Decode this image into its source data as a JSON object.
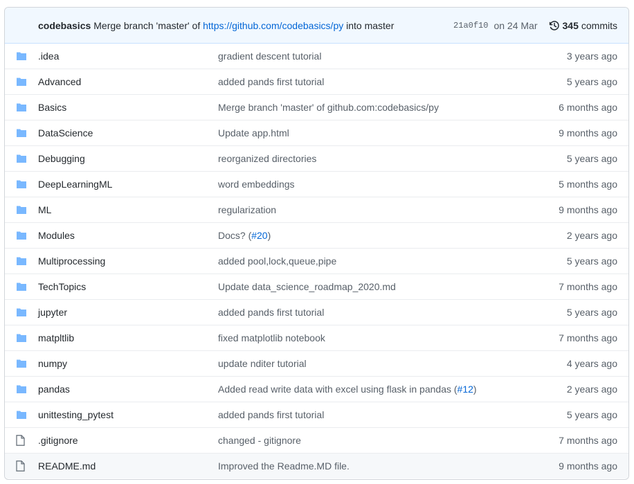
{
  "commit": {
    "author": "codebasics",
    "message_prefix": "Merge branch 'master' of",
    "message_link": "https://github.com/codebasics/py",
    "message_suffix": "into master",
    "sha": "21a0f10",
    "date": "on 24 Mar",
    "count": "345",
    "count_label": "commits",
    "history_icon": "history-icon"
  },
  "colors": {
    "folder": "#79b8ff",
    "link": "#0366d6",
    "header_bg": "#f1f8ff"
  },
  "files": [
    {
      "type": "folder",
      "name": ".idea",
      "message": "gradient descent tutorial",
      "age": "3 years ago"
    },
    {
      "type": "folder",
      "name": "Advanced",
      "message": "added pands first tutorial",
      "age": "5 years ago"
    },
    {
      "type": "folder",
      "name": "Basics",
      "message": "Merge branch 'master' of github.com:codebasics/py",
      "age": "6 months ago"
    },
    {
      "type": "folder",
      "name": "DataScience",
      "message": "Update app.html",
      "age": "9 months ago"
    },
    {
      "type": "folder",
      "name": "Debugging",
      "message": "reorganized directories",
      "age": "5 years ago"
    },
    {
      "type": "folder",
      "name": "DeepLearningML",
      "message": "word embeddings",
      "age": "5 months ago"
    },
    {
      "type": "folder",
      "name": "ML",
      "message": "regularization",
      "age": "9 months ago"
    },
    {
      "type": "folder",
      "name": "Modules",
      "message": "Docs? (",
      "message_link": "#20",
      "message_end": ")",
      "age": "2 years ago"
    },
    {
      "type": "folder",
      "name": "Multiprocessing",
      "message": "added pool,lock,queue,pipe",
      "age": "5 years ago"
    },
    {
      "type": "folder",
      "name": "TechTopics",
      "message": "Update data_science_roadmap_2020.md",
      "age": "7 months ago"
    },
    {
      "type": "folder",
      "name": "jupyter",
      "message": "added pands first tutorial",
      "age": "5 years ago"
    },
    {
      "type": "folder",
      "name": "matpltlib",
      "message": "fixed matplotlib notebook",
      "age": "7 months ago"
    },
    {
      "type": "folder",
      "name": "numpy",
      "message": "update nditer tutorial",
      "age": "4 years ago"
    },
    {
      "type": "folder",
      "name": "pandas",
      "message": "Added read write data with excel using flask in pandas (",
      "message_link": "#12",
      "message_end": ")",
      "age": "2 years ago"
    },
    {
      "type": "folder",
      "name": "unittesting_pytest",
      "message": "added pands first tutorial",
      "age": "5 years ago"
    },
    {
      "type": "file",
      "name": ".gitignore",
      "message": "changed - gitignore",
      "age": "7 months ago"
    },
    {
      "type": "file",
      "name": "README.md",
      "message": "Improved the Readme.MD file.",
      "age": "9 months ago"
    }
  ]
}
